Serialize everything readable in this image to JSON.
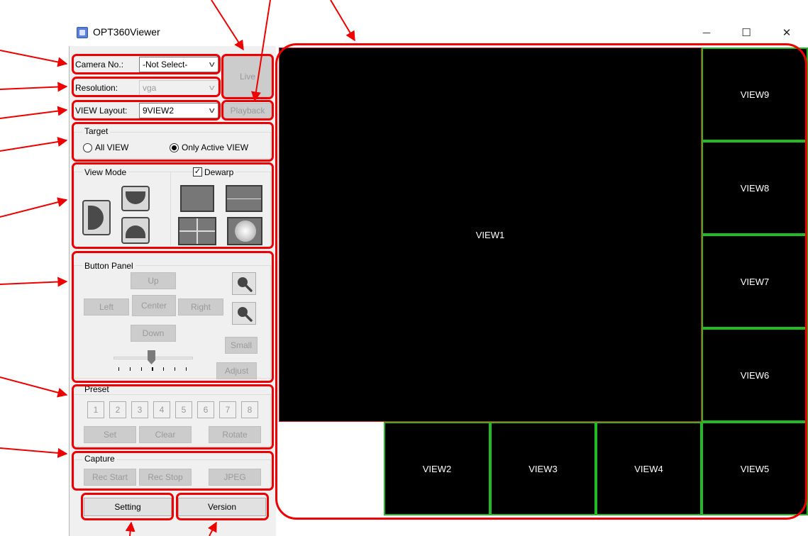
{
  "window": {
    "title": "OPT360Viewer",
    "minimize_glyph": "—",
    "maximize_glyph": "☐",
    "close_glyph": "✕"
  },
  "camera": {
    "label": "Camera No.:",
    "value": "-Not Select-"
  },
  "resolution": {
    "label": "Resolution:",
    "value": "vga"
  },
  "layout": {
    "label": "VIEW Layout:",
    "value": "9VIEW2"
  },
  "mode_buttons": {
    "live": "Live",
    "playback": "Playback"
  },
  "target": {
    "title": "Target",
    "all_view": "All VIEW",
    "only_active": "Only Active VIEW",
    "selected": "only_active"
  },
  "view_mode": {
    "title": "View Mode",
    "dewarp_label": "Dewarp",
    "dewarp_checked": true
  },
  "button_panel": {
    "title": "Button Panel",
    "up": "Up",
    "left": "Left",
    "center": "Center",
    "right": "Right",
    "down": "Down",
    "small": "Small",
    "adjust": "Adjust"
  },
  "preset": {
    "title": "Preset",
    "numbers": [
      "1",
      "2",
      "3",
      "4",
      "5",
      "6",
      "7",
      "8"
    ],
    "set": "Set",
    "clear": "Clear",
    "rotate": "Rotate"
  },
  "capture": {
    "title": "Capture",
    "rec_start": "Rec Start",
    "rec_stop": "Rec Stop",
    "jpeg": "JPEG"
  },
  "footer": {
    "setting": "Setting",
    "version": "Version"
  },
  "views": {
    "v1": "VIEW1",
    "v2": "VIEW2",
    "v3": "VIEW3",
    "v4": "VIEW4",
    "v5": "VIEW5",
    "v6": "VIEW6",
    "v7": "VIEW7",
    "v8": "VIEW8",
    "v9": "VIEW9"
  },
  "colors": {
    "annotation": "#ee0000",
    "active_view_border": "#cc2222",
    "view_border": "#22bb22",
    "view_background": "#000000"
  }
}
